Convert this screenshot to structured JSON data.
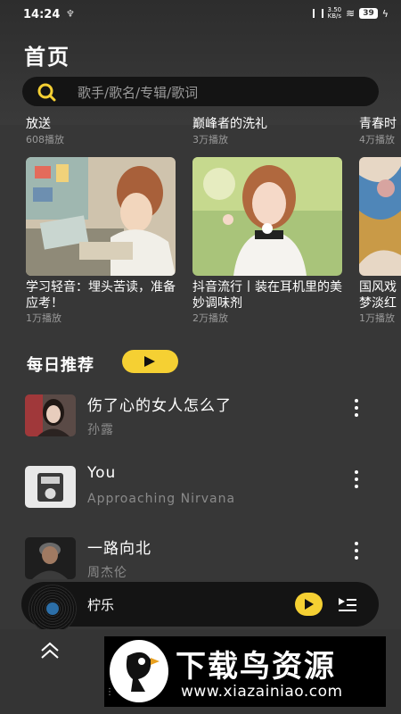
{
  "status": {
    "time": "14:24",
    "net_speed_top": "3.50",
    "net_speed_unit": "KB/s",
    "battery": "39"
  },
  "header": {
    "title": "首页"
  },
  "search": {
    "placeholder": "歌手/歌名/专辑/歌词"
  },
  "top_playlists": [
    {
      "title": "放送",
      "count": "608播放"
    },
    {
      "title": "巅峰者的洗礼",
      "count": "3万播放"
    },
    {
      "title": "青春时",
      "count": "4万播放"
    }
  ],
  "playlists": [
    {
      "title": "学习轻音：埋头苦读，准备应考！",
      "count": "1万播放"
    },
    {
      "title": "抖音流行丨装在耳机里的美妙调味剂",
      "count": "2万播放"
    },
    {
      "title": "国风戏梦淡红",
      "count": "1万播放"
    }
  ],
  "daily": {
    "title": "每日推荐"
  },
  "songs": [
    {
      "name": "伤了心的女人怎么了",
      "artist": "孙露"
    },
    {
      "name": "You",
      "artist": "Approaching Nirvana"
    },
    {
      "name": "一路向北",
      "artist": "周杰伦"
    }
  ],
  "player": {
    "title": "柠乐"
  },
  "watermark": {
    "text": "下载鸟资源",
    "url": "www.xiazainiao.com"
  },
  "colors": {
    "accent": "#f5d033",
    "background": "#373737",
    "search_bg": "#141414"
  }
}
